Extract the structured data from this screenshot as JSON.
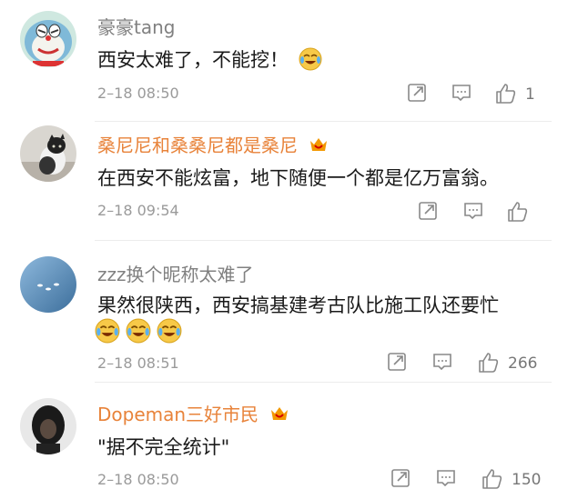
{
  "comments": [
    {
      "username": "豪豪tang",
      "text": "西安太难了，不能挖！",
      "time": "2–18 08:50",
      "likes": "1",
      "avatar": "doraemon-cartoon-avatar",
      "name_color": "#808080"
    },
    {
      "username": "桑尼尼和桑桑尼都是桑尼",
      "text": "在西安不能炫富，地下随便一个都是亿万富翁。",
      "time": "2–18 09:54",
      "likes": "",
      "avatar": "cat-photo-avatar",
      "name_color": "#e8833a"
    },
    {
      "username": "zzz换个昵称太难了",
      "text": "果然很陕西，西安搞基建考古队比施工队还要忙",
      "time": "2–18 08:51",
      "likes": "266",
      "avatar": "blue-sky-avatar",
      "name_color": "#808080"
    },
    {
      "username": "Dopeman三好市民",
      "text": "\"据不完全统计\"",
      "time": "2–18 08:50",
      "likes": "150",
      "avatar": "dark-portrait-avatar",
      "name_color": "#e8833a"
    }
  ],
  "icons": {
    "share": "share-icon",
    "comment": "comment-icon",
    "like": "like-icon",
    "laugh": "laugh-cry-emoji",
    "vip": "vip-crown-badge"
  }
}
